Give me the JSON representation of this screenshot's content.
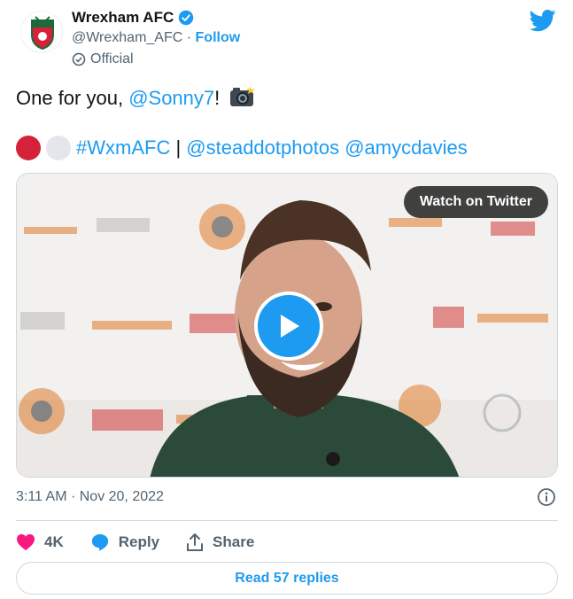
{
  "account": {
    "name": "Wrexham AFC",
    "handle": "@Wrexham_AFC",
    "separator": " · ",
    "follow_label": "Follow",
    "official_label": "Official"
  },
  "tweet": {
    "line1_prefix": "One for you, ",
    "mention": "@Sonny7",
    "line1_suffix": "!",
    "hashtag": "#WxmAFC",
    "pipe": " | ",
    "mention2": "@steaddotphotos",
    "mention3": "@amycdavies"
  },
  "media": {
    "watch_label": "Watch on Twitter"
  },
  "timestamp": "3:11 AM · Nov 20, 2022",
  "actions": {
    "likes": "4K",
    "reply_label": "Reply",
    "share_label": "Share"
  },
  "read_replies_label": "Read 57 replies",
  "colors": {
    "accent": "#1d9bf0",
    "like": "#f91880",
    "club_red": "#d6213a"
  },
  "icons": [
    "verified-badge-icon",
    "twitter-bird-icon",
    "official-check-icon",
    "camera-flash-emoji",
    "red-circle-emoji",
    "white-circle-emoji",
    "play-icon",
    "info-icon",
    "heart-icon",
    "reply-bubble-icon",
    "share-icon"
  ]
}
